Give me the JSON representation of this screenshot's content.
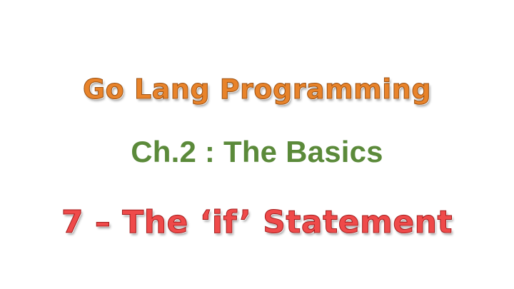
{
  "slide": {
    "title": "Go Lang Programming",
    "subtitle": "Ch.2 : The Basics",
    "lesson": "7 – The ‘if’ Statement"
  },
  "colors": {
    "title": "#e8832a",
    "subtitle": "#5b8a3a",
    "lesson": "#ef4a4a",
    "background": "#ffffff"
  }
}
